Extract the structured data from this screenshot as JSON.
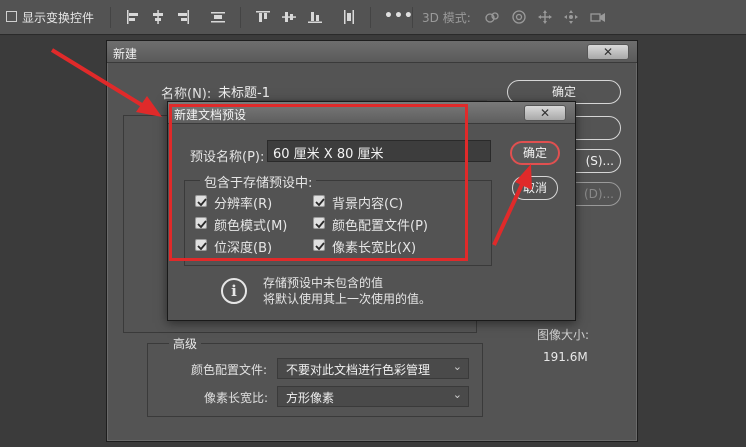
{
  "optionsbar": {
    "show_transform_label": "显示变换控件",
    "more_label": "•••",
    "mode3d_label": "3D 模式:"
  },
  "new_dialog": {
    "title": "新建",
    "close_label": "✕",
    "name_label": "名称(N):",
    "name_value": "未标题-1",
    "ok_label": "确定",
    "side_button_1": "(S)...",
    "side_button_2": "(D)...",
    "image_size_label": "图像大小:",
    "image_size_value": "191.6M",
    "advanced": {
      "title": "高级",
      "color_profile_label": "颜色配置文件:",
      "color_profile_value": "不要对此文档进行色彩管理",
      "pixel_aspect_label": "像素长宽比:",
      "pixel_aspect_value": "方形像素"
    }
  },
  "preset_dialog": {
    "title": "新建文档预设",
    "close_label": "✕",
    "preset_name_label": "预设名称(P):",
    "preset_name_value": "60 厘米 X 80 厘米",
    "ok_label": "确定",
    "cancel_label": "取消",
    "group_title": "包含于存储预设中:",
    "options": [
      {
        "label": "分辨率(R)",
        "checked": true
      },
      {
        "label": "背景内容(C)",
        "checked": true
      },
      {
        "label": "颜色模式(M)",
        "checked": true
      },
      {
        "label": "颜色配置文件(P)",
        "checked": true
      },
      {
        "label": "位深度(B)",
        "checked": true
      },
      {
        "label": "像素长宽比(X)",
        "checked": true
      }
    ],
    "info_line_1": "存储预设中未包含的值",
    "info_line_2": "将默认使用其上一次使用的值。"
  },
  "colors": {
    "annotation_red": "#e02a2a",
    "dialog_bg": "#535353",
    "toolbar_bg": "#535353"
  }
}
